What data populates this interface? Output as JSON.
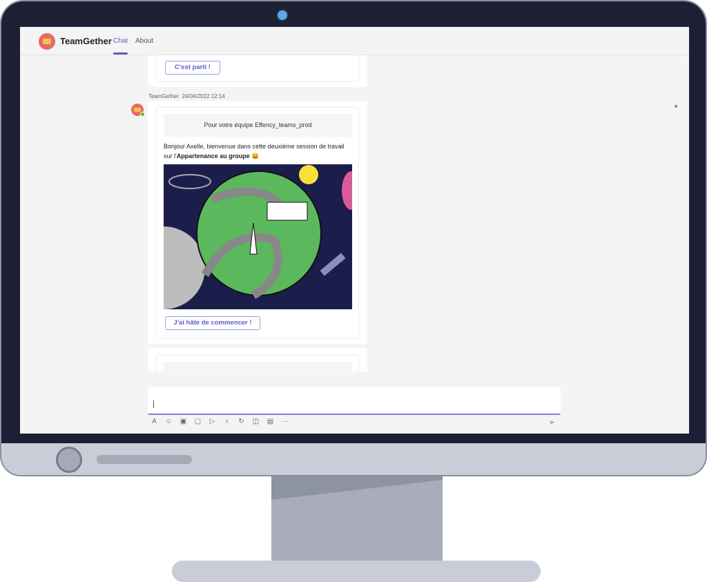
{
  "app": {
    "title": "TeamGether",
    "tabs": [
      {
        "label": "Chat",
        "active": true
      },
      {
        "label": "About"
      }
    ]
  },
  "messages": [
    {
      "button": "C'est parti !"
    },
    {
      "sender": "TeamGether",
      "timestamp": "24/04/2022 12:14",
      "team_header": "Pour votre équipe Effency_teams_prod",
      "intro_plain": "Bonjour Axelle, bienvenue dans cette deuxième session de travail sur l'",
      "intro_bold": "Appartenance au groupe",
      "emoji": "😄",
      "button": "J'ai hâte de commencer !"
    }
  ],
  "composer": {
    "value": "",
    "tools": [
      "format-icon",
      "emoji-icon",
      "gif-icon",
      "sticker-icon",
      "meet-icon",
      "praise-icon",
      "loop-icon",
      "attach-icon",
      "schedule-icon",
      "more-icon"
    ],
    "send_icon": "send-icon"
  },
  "colors": {
    "accent": "#5b5fc7",
    "bezel": "#1d1f34"
  }
}
